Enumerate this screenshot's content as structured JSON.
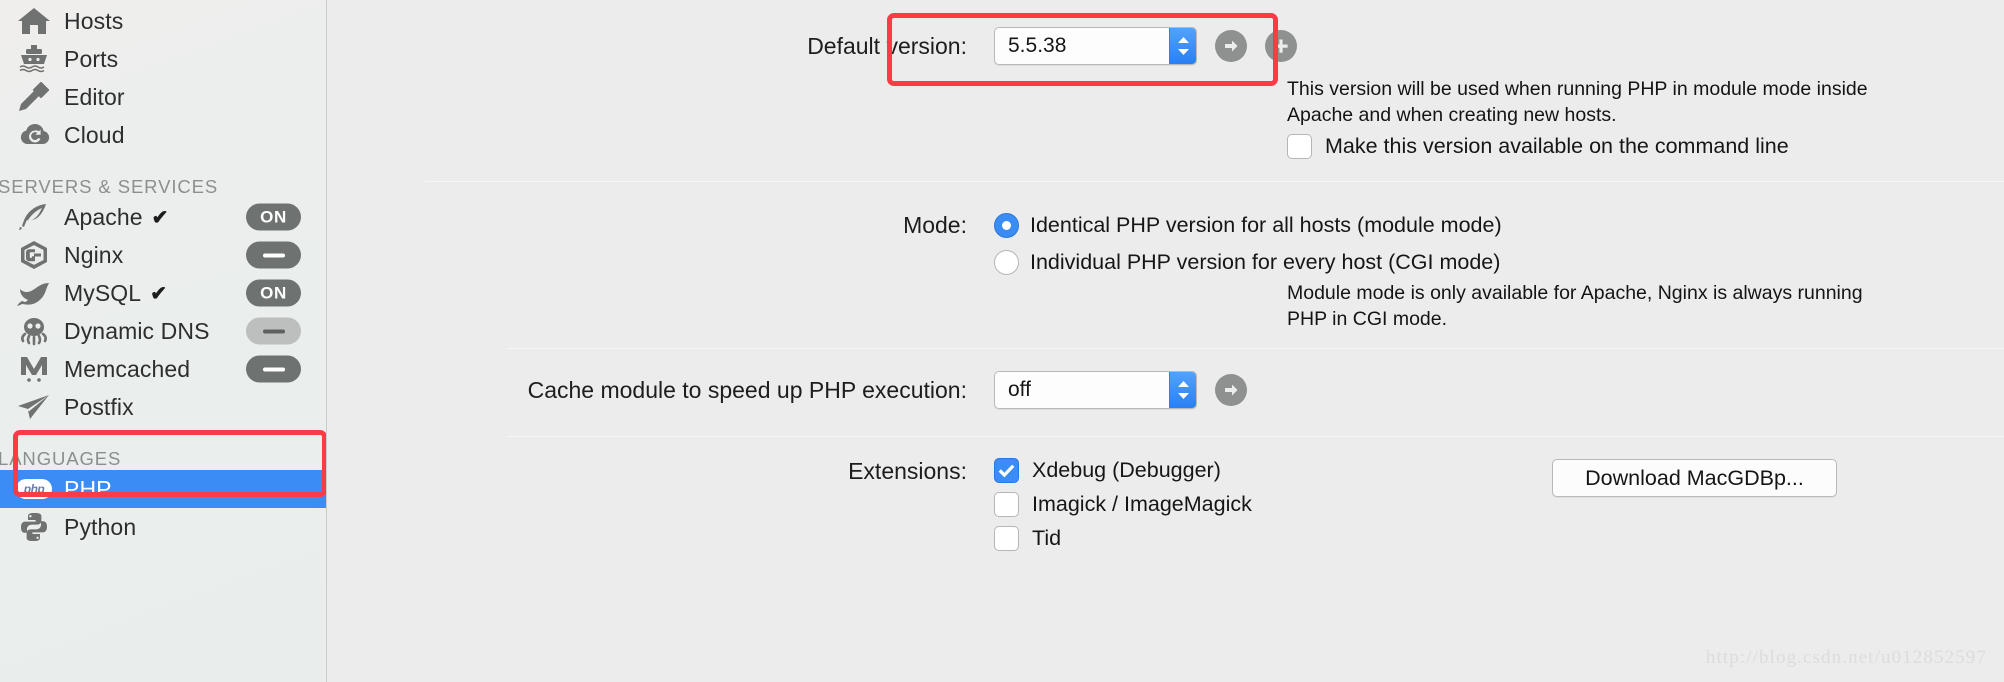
{
  "colors": {
    "accent": "#3b8cf4",
    "annotation": "#fb3b46",
    "sidebar_bg": "#eaeeec",
    "content_bg": "#ececec",
    "pill_on": "#6e7271",
    "pill_off_light": "#bcbfbe"
  },
  "sidebar": {
    "top_items": [
      {
        "label": "Hosts",
        "icon": "home-icon",
        "checked": false,
        "pill": null
      },
      {
        "label": "Ports",
        "icon": "ship-icon",
        "checked": false,
        "pill": null
      },
      {
        "label": "Editor",
        "icon": "pen-nib-icon",
        "checked": false,
        "pill": null
      },
      {
        "label": "Cloud",
        "icon": "cloud-sync-icon",
        "checked": false,
        "pill": null
      }
    ],
    "group_servers": {
      "title": "SERVERS & SERVICES",
      "items": [
        {
          "label": "Apache",
          "icon": "feather-icon",
          "checked": true,
          "pill": "ON",
          "pill_state": "on"
        },
        {
          "label": "Nginx",
          "icon": "nginx-g-icon",
          "checked": false,
          "pill": "dash",
          "pill_state": "on"
        },
        {
          "label": "MySQL",
          "icon": "dolphin-icon",
          "checked": true,
          "pill": "ON",
          "pill_state": "on"
        },
        {
          "label": "Dynamic DNS",
          "icon": "octopus-icon",
          "checked": false,
          "pill": "dash",
          "pill_state": "light"
        },
        {
          "label": "Memcached",
          "icon": "memcached-m-icon",
          "checked": false,
          "pill": "dash",
          "pill_state": "on"
        },
        {
          "label": "Postfix",
          "icon": "paper-plane-icon",
          "checked": false,
          "pill": null
        }
      ]
    },
    "group_languages": {
      "title": "LANGUAGES",
      "items": [
        {
          "label": "PHP",
          "icon": "php-logo-icon",
          "selected": true
        },
        {
          "label": "Python",
          "icon": "python-logo-icon",
          "selected": false
        }
      ]
    }
  },
  "main": {
    "default_version": {
      "label": "Default version:",
      "value": "5.5.38",
      "stepper_icon": "stepper-up-down-icon",
      "go_icon": "arrow-right-circle-icon",
      "add_icon": "plus-circle-icon",
      "help": [
        "This version will be used when running PHP in module mode inside",
        "Apache and when creating new hosts."
      ],
      "cli_checkbox": {
        "label": "Make this version available on the command line",
        "checked": false
      }
    },
    "mode": {
      "label": "Mode:",
      "options": [
        {
          "label": "Identical PHP version for all hosts (module mode)",
          "selected": true
        },
        {
          "label": "Individual PHP version for every host (CGI mode)",
          "selected": false
        }
      ],
      "help": [
        "Module mode is only available for Apache, Nginx is always running",
        "PHP in CGI mode."
      ]
    },
    "cache_module": {
      "label": "Cache module to speed up PHP execution:",
      "value": "off",
      "stepper_icon": "stepper-up-down-icon",
      "go_icon": "arrow-right-circle-icon"
    },
    "extensions": {
      "label": "Extensions:",
      "items": [
        {
          "label": "Xdebug (Debugger)",
          "checked": true
        },
        {
          "label": "Imagick / ImageMagick",
          "checked": false
        },
        {
          "label": "Tid",
          "checked": false
        }
      ],
      "download_button": "Download MacGDBp..."
    }
  },
  "watermark": "http://blog.csdn.net/u012852597"
}
